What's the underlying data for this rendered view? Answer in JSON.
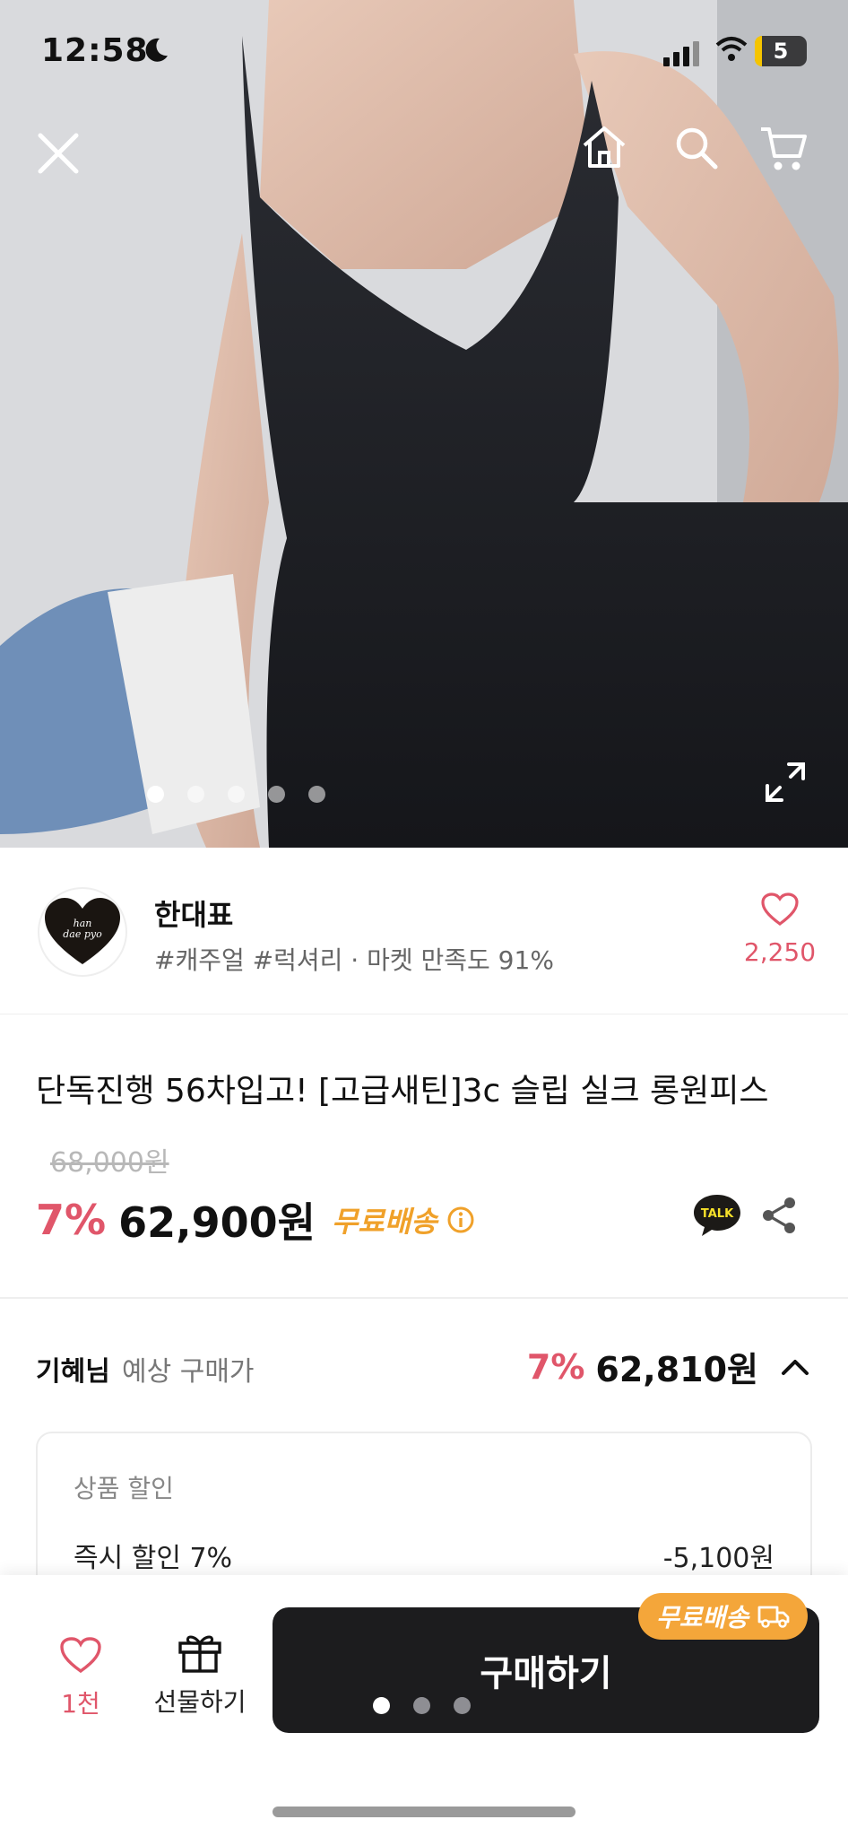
{
  "status_bar": {
    "time": "12:58",
    "battery": "5"
  },
  "hero": {
    "image_description": "Model wearing black satin slip long dress",
    "dots_total": 5,
    "dots_active_index": 0
  },
  "seller": {
    "name": "한대표",
    "tags": "#캐주얼 #럭셔리 · 마켓 만족도 91%",
    "logo_text": "han dae pyo",
    "like_count": "2,250"
  },
  "product": {
    "title": "단독진행 56차입고! [고급새틴]3c 슬립 실크 롱원피스",
    "original_price": "68,000원",
    "discount": "7%",
    "price": "62,900원",
    "free_shipping": "무료배송",
    "talk_label": "TALK"
  },
  "estimate": {
    "user": "기혜님",
    "label": "예상 구매가",
    "discount": "7%",
    "price": "62,810원"
  },
  "discount_box": {
    "heading": "상품 할인",
    "row_label": "즉시 할인 7%",
    "row_value": "-5,100원"
  },
  "bottom_bar": {
    "like_count": "1천",
    "gift_label": "선물하기",
    "buy_label": "구매하기",
    "badge_label": "무료배송"
  },
  "colors": {
    "accent": "#e0566a",
    "badge": "#f4a63a",
    "buy_button": "#1c1c1e"
  }
}
